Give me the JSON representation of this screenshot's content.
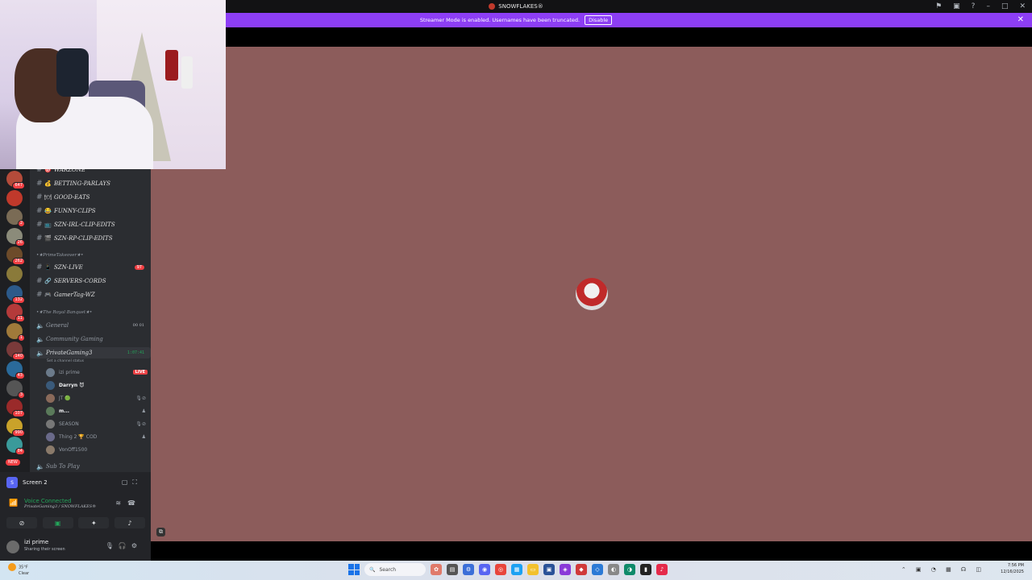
{
  "window": {
    "title": "SNOWFLAKES®"
  },
  "banner": {
    "message": "Streamer Mode is enabled. Usernames have been truncated.",
    "disable_label": "Disable"
  },
  "rail": {
    "servers": [
      {
        "badge": "647",
        "color": "#b44b3a"
      },
      {
        "badge": "",
        "color": "#c0392b"
      },
      {
        "badge": "2",
        "color": "#7a6b55"
      },
      {
        "badge": "26",
        "color": "#8b8b7a"
      },
      {
        "badge": "262",
        "color": "#6d4b2a"
      },
      {
        "badge": "",
        "color": "#8a7a3a"
      },
      {
        "badge": "132",
        "color": "#2c5a8a"
      },
      {
        "badge": "11",
        "color": "#b43a3a"
      },
      {
        "badge": "1",
        "color": "#a07a3a"
      },
      {
        "badge": "140",
        "color": "#7a3a3a"
      },
      {
        "badge": "43",
        "color": "#2a6a9a"
      },
      {
        "badge": "3",
        "color": "#555"
      },
      {
        "badge": "107",
        "color": "#9a2a2a"
      },
      {
        "badge": "990",
        "color": "#c9a22a"
      },
      {
        "badge": "84",
        "color": "#3a9a9a"
      }
    ],
    "new_label": "NEW"
  },
  "sidebar": {
    "channels": [
      {
        "emoji": "🎯",
        "name": "WARZONE"
      },
      {
        "emoji": "💰",
        "name": "BETTING-PARLAYS"
      },
      {
        "emoji": "🍽",
        "name": "GOOD-EATS"
      },
      {
        "emoji": "😂",
        "name": "FUNNY-CLIPS"
      },
      {
        "emoji": "📺",
        "name": "SZN-IRL-CLIP-EDITS"
      },
      {
        "emoji": "🎬",
        "name": "SZN-RP-CLIP-EDITS"
      }
    ],
    "category1": "•★PrimeTakeover★•",
    "channels2": [
      {
        "emoji": "📱",
        "name": "SZN-LIVE",
        "mention": "97"
      },
      {
        "emoji": "🔗",
        "name": "SERVERS-CORDS",
        "mention": ""
      },
      {
        "emoji": "🎮",
        "name": "GamerTag-WZ",
        "mention": ""
      }
    ],
    "category2": "•★The Royal Banquet★•",
    "voice": [
      {
        "name": "General",
        "counts": "00  01"
      },
      {
        "name": "Community Gaming",
        "counts": ""
      }
    ],
    "active_voice": {
      "name": "PrivateGaming3",
      "time": "1:07:41"
    },
    "channel_status": "Set a channel status",
    "members": [
      {
        "name": "izi prime",
        "live": "LIVE",
        "bright": false
      },
      {
        "name": "Darryn 😈",
        "bright": true
      },
      {
        "name": "JT 🟢",
        "bright": false
      },
      {
        "name": "m...",
        "bright": true
      },
      {
        "name": "SEASON",
        "bright": false
      },
      {
        "name": "Thing 2 🏆 COD",
        "bright": false
      },
      {
        "name": "VonOff1500",
        "bright": false
      }
    ],
    "last_voice": "Sub To Play"
  },
  "panel": {
    "screen_label": "Screen 2",
    "voice_connected": "Voice Connected",
    "voice_location": "PrivateGaming3 / SNOWFLAKES®",
    "user_name": "izi prime",
    "user_status": "Sharing their screen"
  },
  "taskbar": {
    "weather_temp": "35°F",
    "weather_desc": "Clear",
    "search_placeholder": "Search",
    "time": "7:56 PM",
    "date": "12/16/2025"
  }
}
